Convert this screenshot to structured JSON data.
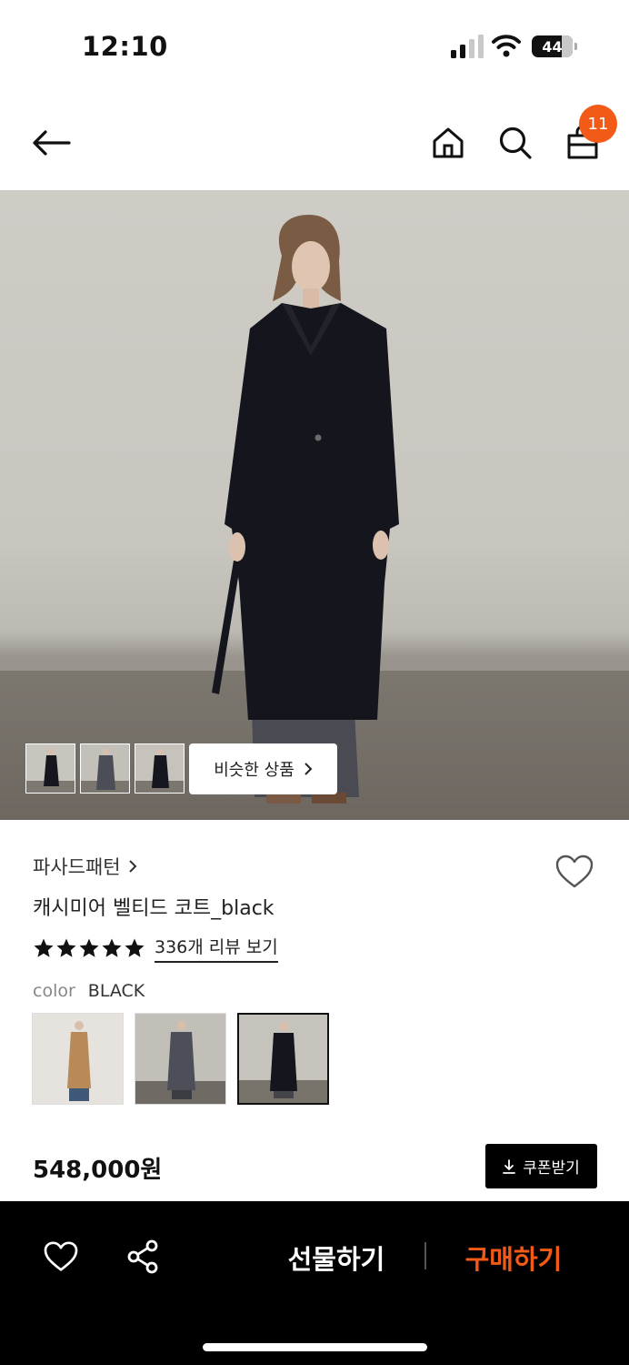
{
  "status_bar": {
    "time": "12:10",
    "battery": "44",
    "icons": [
      "signal-icon",
      "wifi-icon",
      "battery-icon"
    ]
  },
  "nav": {
    "icons": [
      "back-arrow-icon",
      "home-icon",
      "search-icon",
      "shopping-bag-icon"
    ],
    "cart_count": "11"
  },
  "gallery": {
    "similar_label": "비슷한 상품",
    "thumbnails": 3
  },
  "product": {
    "brand": "파사드패턴",
    "name": "캐시미어 벨티드 코트_black",
    "rating": 5,
    "review_link": "336개 리뷰 보기",
    "color_label": "color",
    "color_value": "BLACK",
    "color_options": [
      "camel",
      "grey",
      "black"
    ],
    "selected_color": "black",
    "price": "548,000원",
    "coupon_label": "쿠폰받기"
  },
  "bottom_bar": {
    "gift_label": "선물하기",
    "buy_label": "구매하기"
  },
  "colors": {
    "accent": "#f25a17",
    "bottom_bar_bg": "#000000"
  }
}
